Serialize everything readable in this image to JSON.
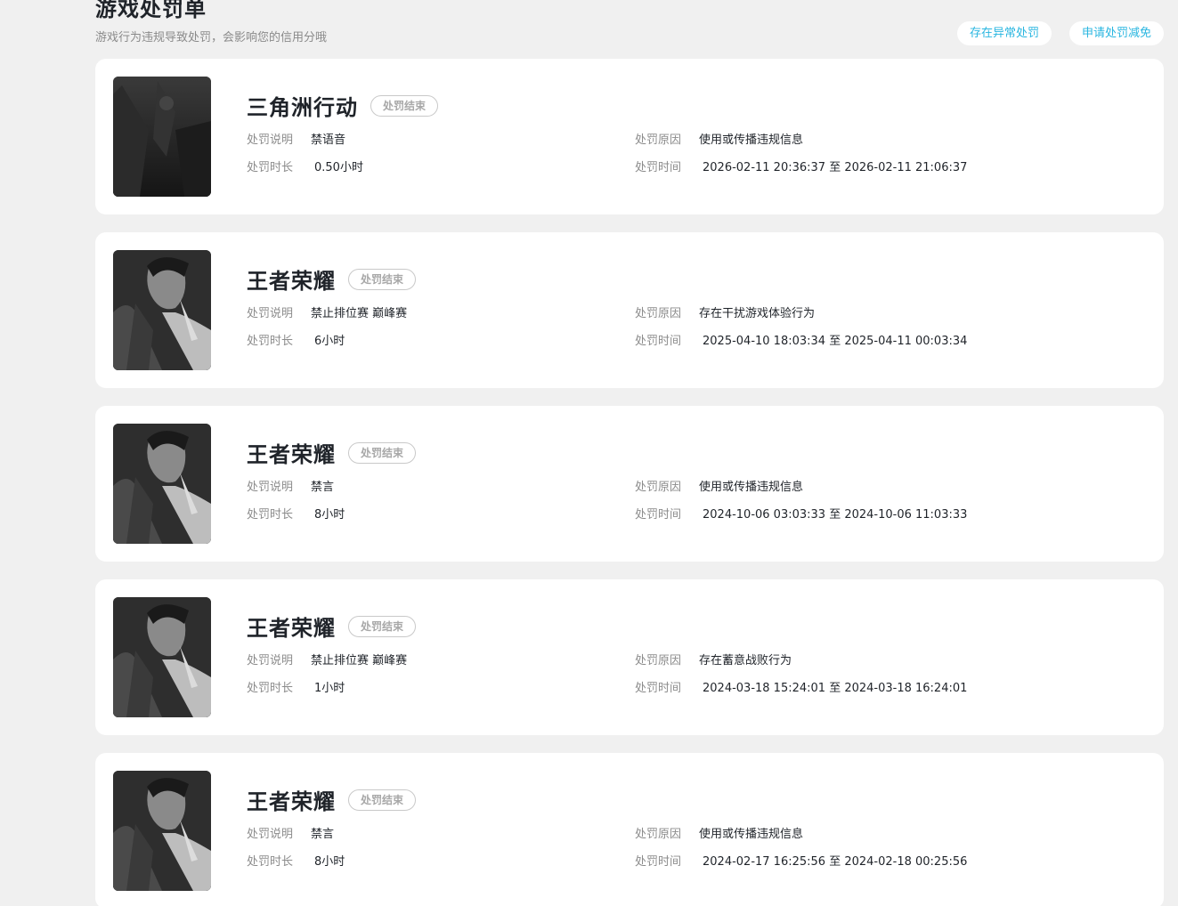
{
  "header": {
    "title": "游戏处罚单",
    "subtitle": "游戏行为违规导致处罚，会影响您的信用分哦",
    "actions": {
      "abnormal_label": "存在异常处罚",
      "apply_reduction_label": "申请处罚减免"
    }
  },
  "labels": {
    "description": "处罚说明",
    "reason": "处罚原因",
    "duration": "处罚时长",
    "time": "处罚时间"
  },
  "records": [
    {
      "game": "三角洲行动",
      "status": "处罚结束",
      "description": "禁语音",
      "reason": "使用或传播违规信息",
      "duration": "0.50小时",
      "time": "2026-02-11 20:36:37 至 2026-02-11 21:06:37",
      "thumb_icon": "delta-force-cover-image"
    },
    {
      "game": "王者荣耀",
      "status": "处罚结束",
      "description": "禁止排位赛 巅峰赛",
      "reason": "存在干扰游戏体验行为",
      "duration": "6小时",
      "time": "2025-04-10 18:03:34 至 2025-04-11 00:03:34",
      "thumb_icon": "honor-of-kings-hero-image"
    },
    {
      "game": "王者荣耀",
      "status": "处罚结束",
      "description": "禁言",
      "reason": "使用或传播违规信息",
      "duration": "8小时",
      "time": "2024-10-06 03:03:33 至 2024-10-06 11:03:33",
      "thumb_icon": "honor-of-kings-hero-image"
    },
    {
      "game": "王者荣耀",
      "status": "处罚结束",
      "description": "禁止排位赛 巅峰赛",
      "reason": "存在蓄意战败行为",
      "duration": "1小时",
      "time": "2024-03-18 15:24:01 至 2024-03-18 16:24:01",
      "thumb_icon": "honor-of-kings-hero-image"
    },
    {
      "game": "王者荣耀",
      "status": "处罚结束",
      "description": "禁言",
      "reason": "使用或传播违规信息",
      "duration": "8小时",
      "time": "2024-02-17 16:25:56 至 2024-02-18 00:25:56",
      "thumb_icon": "honor-of-kings-hero-image"
    }
  ],
  "colors": {
    "page_bg": "#f0f0f0",
    "card_bg": "#ffffff",
    "accent": "#29b6e0",
    "title_text": "#1f2329",
    "muted_text": "#8c8c8c",
    "badge_border": "#c9c9c9"
  }
}
